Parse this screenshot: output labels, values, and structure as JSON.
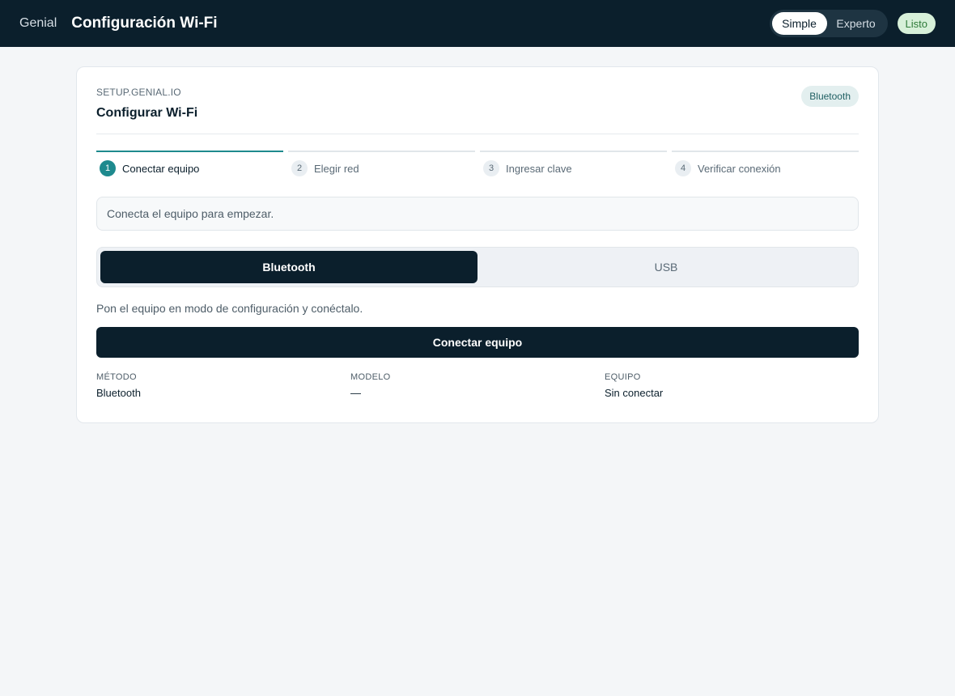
{
  "topbar": {
    "brand": "Genial",
    "title": "Configuración Wi-Fi",
    "modes": [
      "Simple",
      "Experto"
    ],
    "active_mode": "Simple",
    "status": "Listo"
  },
  "card": {
    "eyebrow": "SETUP.GENIAL.IO",
    "title": "Configurar Wi-Fi",
    "badge": "Bluetooth"
  },
  "steps": [
    {
      "num": "1",
      "label": "Conectar equipo",
      "active": true
    },
    {
      "num": "2",
      "label": "Elegir red",
      "active": false
    },
    {
      "num": "3",
      "label": "Ingresar clave",
      "active": false
    },
    {
      "num": "4",
      "label": "Verificar conexión",
      "active": false
    }
  ],
  "info": "Conecta el equipo para empezar.",
  "methods": {
    "options": [
      "Bluetooth",
      "USB"
    ],
    "selected": "Bluetooth"
  },
  "hint": "Pon el equipo en modo de configuración y conéctalo.",
  "connect_button": "Conectar equipo",
  "meta": [
    {
      "label": "MÉTODO",
      "value": "Bluetooth"
    },
    {
      "label": "MODELO",
      "value": "—"
    },
    {
      "label": "EQUIPO",
      "value": "Sin conectar"
    }
  ],
  "colors": {
    "dark": "#0b1f2c",
    "accent": "#1e8a8e",
    "status_bg": "#d7f0d9",
    "status_text": "#2d7a38"
  }
}
